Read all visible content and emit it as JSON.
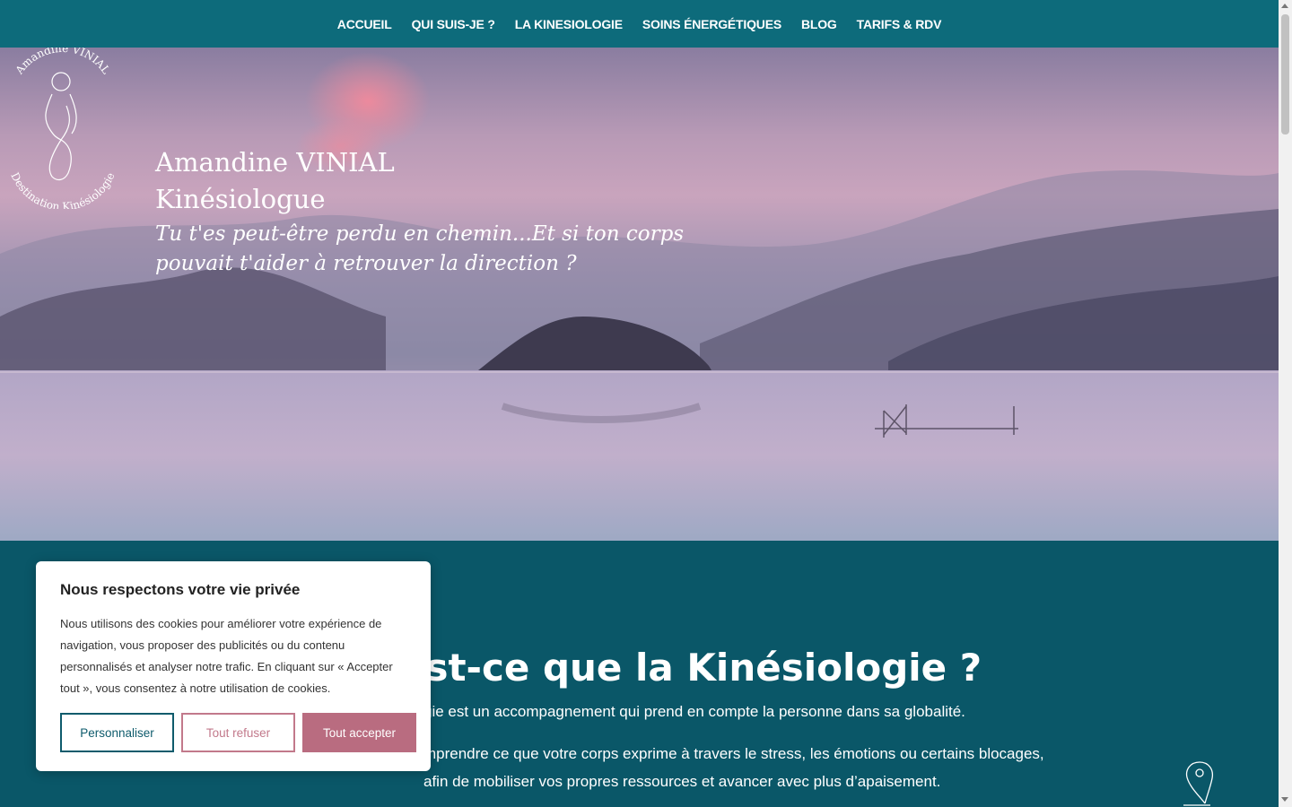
{
  "nav": {
    "items": [
      {
        "label": "ACCUEIL"
      },
      {
        "label": "QUI SUIS-JE ?"
      },
      {
        "label": "LA KINESIOLOGIE"
      },
      {
        "label": "SOINS ÉNERGÉTIQUES"
      },
      {
        "label": "BLOG"
      },
      {
        "label": "TARIFS & RDV"
      }
    ],
    "background": "#0d6b7b"
  },
  "hero": {
    "name": "Amandine VINIAL",
    "role": "Kinésiologue",
    "tagline": "Tu t'es peut-être perdu en chemin...Et si ton corps pouvait t'aider à retrouver la direction ?",
    "logo": {
      "top_text": "Amandine VINIAL",
      "bottom_text": "Destination Kinésiologie"
    }
  },
  "section": {
    "title": "’est-ce que la Kinésiologie ?",
    "paragraph1": "gie est un accompagnement qui prend en compte la personne dans sa globalité.",
    "paragraph2": "mprendre ce que votre corps exprime à travers le stress, les émotions ou certains blocages, afin de mobiliser vos propres ressources et avancer avec plus d’apaisement.",
    "background": "#0a5768"
  },
  "cookie": {
    "title": "Nous respectons votre vie privée",
    "text": "Nous utilisons des cookies pour améliorer votre expérience de navigation, vous proposer des publicités ou du contenu personnalisés et analyser notre trafic. En cliquant sur « Accepter tout », vous consentez à notre utilisation de cookies.",
    "customize_label": "Personnaliser",
    "refuse_label": "Tout refuser",
    "accept_label": "Tout accepter",
    "accent": "#b96c80"
  },
  "icons": {
    "location": "location-pin-icon"
  }
}
